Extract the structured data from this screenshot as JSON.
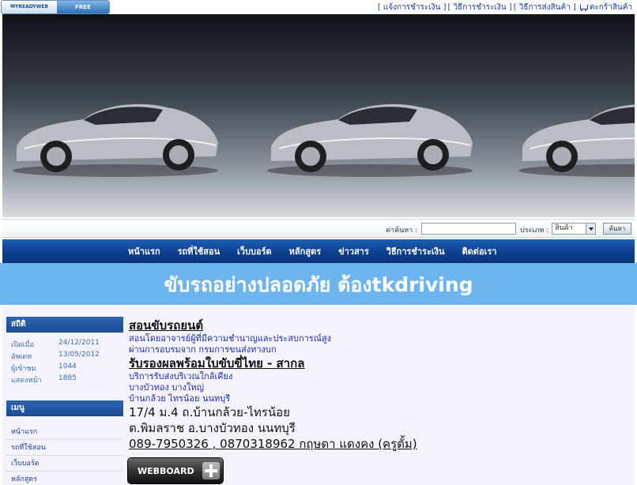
{
  "topbar": {
    "logo_main": "MYREADYWEB",
    "logo_free": "FREE",
    "links": [
      "[ แจ้งการชำระเงิน ]",
      "[ วิธีการชำระเงิน ]",
      "[ วิธีการส่งสินค้า ]"
    ],
    "cart_label": "ตะกร้าสินค้า"
  },
  "search": {
    "label": "ค่าค้นหา :",
    "input_value": "",
    "type_label": "ประเภท :",
    "type_selected": "สินค้า",
    "button_label": "ค้นหา"
  },
  "nav": {
    "items": [
      "หน้าแรก",
      "รถที่ใช้สอน",
      "เว็บบอร์ด",
      "หลักสูตร",
      "ข่าวสาร",
      "วิธีการชำระเงิน",
      "ติดต่อเรา"
    ]
  },
  "heading": "ขับรถอย่างปลอดภัย ต้องtkdriving",
  "sidebar": {
    "stats_title": "สถิติ",
    "stats": [
      {
        "label": "เปิดเมื่อ",
        "value": "24/12/2011"
      },
      {
        "label": "อัพเดท",
        "value": "13/05/2012"
      },
      {
        "label": "ผู้เข้าชม",
        "value": "1044"
      },
      {
        "label": "แสดงหน้า",
        "value": "1885"
      }
    ],
    "menu_title": "เมนู",
    "menu": [
      "หน้าแรก",
      "รถที่ใช้สอน",
      "เว็บบอร์ด",
      "หลักสูตร"
    ]
  },
  "main": {
    "title1": "สอนขับรถยนต์",
    "line1": "สอนโดยอาจารย์ผู้ที่มีความชำนาญและประสบการณ์สูง",
    "line2": "ผ่านการอบรมจาก กรมการขนส่งทางบก",
    "title2": "รับรองผลพร้อมใบขับขี่ไทย - สากล",
    "line3": "บริการรับส่งบริเวณใกล้เคียง",
    "line4": "บางบัวทอง บางใหญ่",
    "line5": "บ้านกล้วย ไทรน้อย นนทบุรี",
    "address1": "17/4 ม.4 ถ.บ้านกล้วย-ไทรน้อย",
    "address2": "ต.พิมลราช อ.บางบัวทอง นนทบุรี",
    "phone": "089-7950326 , 0870318962 กฤษดา แดงคง (ครูตั้ม)"
  },
  "webboard": {
    "label": "WEBBOARD"
  },
  "colors": {
    "nav": "#0d3f8e",
    "heading_band": "#6eb4ef",
    "link": "#1a2fb0"
  }
}
